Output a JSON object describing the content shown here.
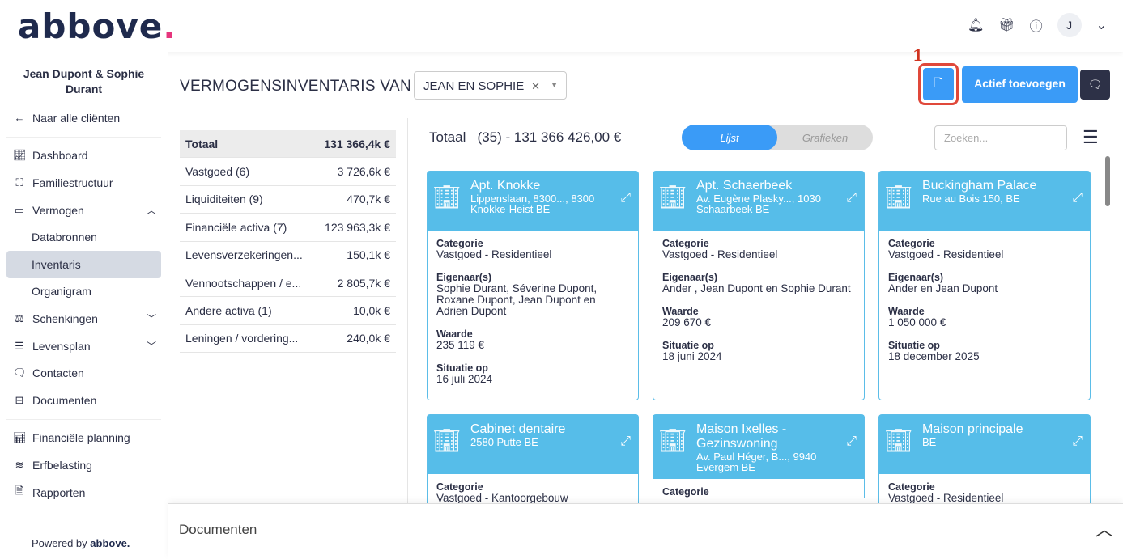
{
  "header": {
    "logo": "abbove",
    "logo_dot": "."
  },
  "user": {
    "initial": "J"
  },
  "sidebar": {
    "client": "Jean Dupont & Sophie Durant",
    "back": "Naar alle cliënten",
    "items": [
      "Dashboard",
      "Familiestructuur",
      "Vermogen",
      "Databronnen",
      "Inventaris",
      "Organigram",
      "Schenkingen",
      "Levensplan",
      "Contacten",
      "Documenten",
      "Financiële planning",
      "Erfbelasting",
      "Rapporten"
    ],
    "powered": "Powered by",
    "powered_brand": "abbove."
  },
  "page": {
    "title": "VERMOGENSINVENTARIS VAN",
    "select_value": "JEAN EN SOPHIE",
    "annotation": "1",
    "add_button": "Actief toevoegen"
  },
  "summary": [
    {
      "label": "Totaal",
      "value": "131 366,4k €"
    },
    {
      "label": "Vastgoed (6)",
      "value": "3 726,6k €"
    },
    {
      "label": "Liquiditeiten (9)",
      "value": "470,7k €"
    },
    {
      "label": "Financiële activa (7)",
      "value": "123 963,3k €"
    },
    {
      "label": "Levensverzekeringen...",
      "value": "150,1k €"
    },
    {
      "label": "Vennootschappen / e...",
      "value": "2 805,7k €"
    },
    {
      "label": "Andere activa (1)",
      "value": "10,0k €"
    },
    {
      "label": "Leningen / vordering...",
      "value": "240,0k €"
    }
  ],
  "list": {
    "total_label": "Totaal",
    "total_value": "(35) - 131 366 426,00 €",
    "tab_list": "Lijst",
    "tab_charts": "Grafieken",
    "search_placeholder": "Zoeken..."
  },
  "labels": {
    "category": "Categorie",
    "owners": "Eigenaar(s)",
    "value": "Waarde",
    "date": "Situatie op"
  },
  "cards": [
    {
      "name": "Apt. Knokke",
      "address": "Lippenslaan, 8300..., 8300 Knokke-Heist BE",
      "category": "Vastgoed - Residentieel",
      "owners": "Sophie Durant, Séverine Dupont, Roxane Dupont, Jean Dupont en Adrien Dupont",
      "value": "235 119 €",
      "date": "16 juli 2024"
    },
    {
      "name": "Apt. Schaerbeek",
      "address": "Av. Eugène Plasky..., 1030 Schaarbeek BE",
      "category": "Vastgoed - Residentieel",
      "owners": "Ander , Jean Dupont en Sophie Durant",
      "value": "209 670 €",
      "date": "18 juni 2024"
    },
    {
      "name": "Buckingham Palace",
      "address": "Rue au Bois 150, BE",
      "category": "Vastgoed - Residentieel",
      "owners": "Ander en Jean Dupont",
      "value": "1 050 000 €",
      "date": "18 december 2025"
    },
    {
      "name": "Cabinet dentaire",
      "address": "2580 Putte BE",
      "category": "Vastgoed - Kantoorgebouw"
    },
    {
      "name": "Maison Ixelles - Gezinswoning",
      "address": "Av. Paul Héger, B..., 9940 Evergem BE"
    },
    {
      "name": "Maison principale",
      "address": "BE",
      "category": "Vastgoed - Residentieel"
    }
  ],
  "docs": {
    "title": "Documenten"
  }
}
